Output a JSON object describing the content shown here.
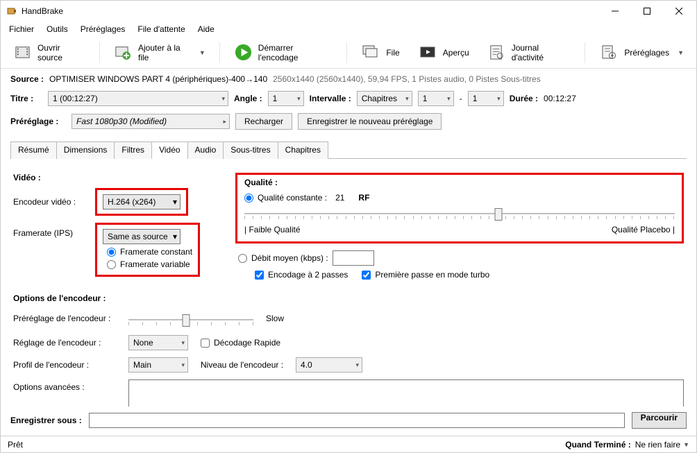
{
  "window": {
    "title": "HandBrake"
  },
  "menu": {
    "file": "Fichier",
    "tools": "Outils",
    "presets": "Préréglages",
    "queue": "File d'attente",
    "help": "Aide"
  },
  "toolbar": {
    "open": "Ouvrir source",
    "add_queue": "Ajouter à la file",
    "start": "Démarrer l'encodage",
    "queue_btn": "File",
    "preview": "Aperçu",
    "activity": "Journal d'activité",
    "presets_btn": "Préréglages"
  },
  "source": {
    "label": "Source :",
    "name": "OPTIMISER WINDOWS PART 4 (périphériques)-400→140",
    "info": "2560x1440 (2560x1440), 59,94 FPS, 1 Pistes audio, 0 Pistes Sous-titres"
  },
  "title_row": {
    "title_label": "Titre :",
    "title_value": "1  (00:12:27)",
    "angle_label": "Angle :",
    "angle_value": "1",
    "range_label": "Intervalle :",
    "range_mode": "Chapitres",
    "range_from": "1",
    "dash": "-",
    "range_to": "1",
    "duration_label": "Durée :",
    "duration_value": "00:12:27"
  },
  "preset_row": {
    "label": "Préréglage :",
    "value": "Fast 1080p30  (Modified)",
    "reload": "Recharger",
    "save_new": "Enregistrer le nouveau préréglage"
  },
  "tabs": {
    "summary": "Résumé",
    "dimensions": "Dimensions",
    "filters": "Filtres",
    "video": "Vidéo",
    "audio": "Audio",
    "subs": "Sous-titres",
    "chapters": "Chapitres"
  },
  "video": {
    "heading": "Vidéo :",
    "encoder_label": "Encodeur vidéo :",
    "encoder_value": "H.264 (x264)",
    "fps_label": "Framerate (IPS)",
    "fps_value": "Same as source",
    "fps_constant": "Framerate constant",
    "fps_variable": "Framerate variable"
  },
  "quality": {
    "heading": "Qualité :",
    "cq_label": "Qualité constante :",
    "cq_value": "21",
    "cq_unit": "RF",
    "low": "| Faible Qualité",
    "high": "Qualité Placebo |",
    "abr_label": "Débit moyen (kbps) :",
    "twopass": "Encodage à 2 passes",
    "turbo": "Première passe en mode turbo",
    "slider_pos_percent": 59
  },
  "enc_opts": {
    "heading": "Options de l'encodeur :",
    "preset_label": "Préréglage de l'encodeur :",
    "preset_value": "Slow",
    "tune_label": "Réglage de l'encodeur :",
    "tune_value": "None",
    "fast_decode": "Décodage Rapide",
    "profile_label": "Profil de l'encodeur :",
    "profile_value": "Main",
    "level_label": "Niveau de l'encodeur :",
    "level_value": "4.0",
    "advanced_label": "Options avancées :",
    "enc_slider_pos_percent": 46
  },
  "saveas": {
    "label": "Enregistrer sous :",
    "browse": "Parcourir"
  },
  "status": {
    "left": "Prêt",
    "done_label": "Quand Terminé :",
    "done_value": "Ne rien faire"
  }
}
